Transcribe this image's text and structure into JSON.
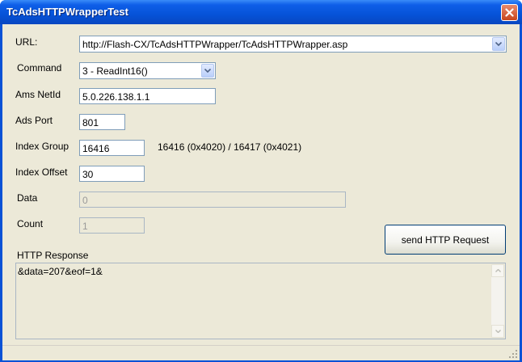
{
  "window": {
    "title": "TcAdsHTTPWrapperTest"
  },
  "form": {
    "url_label": "URL:",
    "url_value": "http://Flash-CX/TcAdsHTTPWrapper/TcAdsHTTPWrapper.asp",
    "command_label": "Command",
    "command_value": "3 - ReadInt16()",
    "amsnetid_label": "Ams NetId",
    "amsnetid_value": "5.0.226.138.1.1",
    "adsport_label": "Ads Port",
    "adsport_value": "801",
    "indexgroup_label": "Index Group",
    "indexgroup_value": "16416",
    "indexgroup_hint": "16416 (0x4020) / 16417 (0x4021)",
    "indexoffset_label": "Index Offset",
    "indexoffset_value": "30",
    "data_label": "Data",
    "data_value": "0",
    "count_label": "Count",
    "count_value": "1",
    "send_button": "send HTTP Request",
    "response_label": "HTTP Response",
    "response_value": "&data=207&eof=1&"
  },
  "icons": {
    "close": "close-icon",
    "dropdown": "chevron-down-icon",
    "scroll_up": "arrow-up-icon",
    "scroll_down": "arrow-down-icon",
    "grip": "resize-grip-icon"
  },
  "colors": {
    "titlebar": "#0653d8",
    "client_bg": "#ece9d8",
    "close_button": "#c8461e",
    "input_border": "#7f9db9"
  }
}
